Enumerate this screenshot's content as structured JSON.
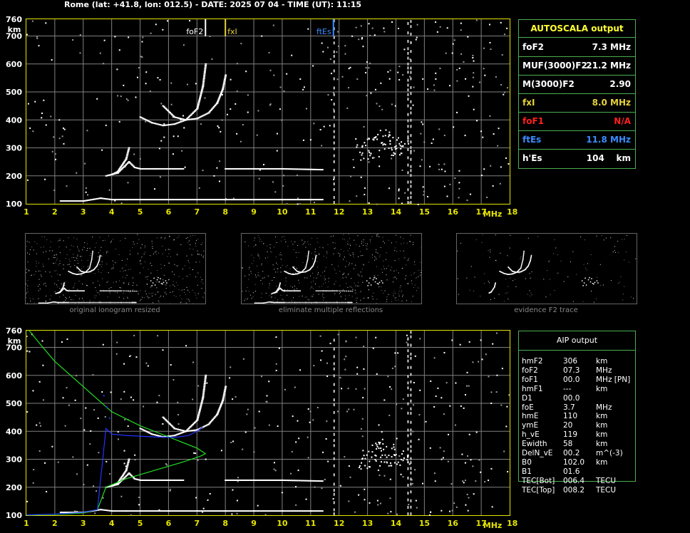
{
  "header": "Rome (lat: +41.8, lon: 012.5) - DATE: 2025 07 04 - TIME (UT): 11:15",
  "autoscala": {
    "title": "AUTOSCALA output",
    "rows": [
      {
        "label": "foF2",
        "value": "7.3 MHz",
        "color": "#ffffff"
      },
      {
        "label": "MUF(3000)F2",
        "value": "21.2 MHz",
        "color": "#ffffff"
      },
      {
        "label": "M(3000)F2",
        "value": "2.90",
        "color": "#ffffff"
      },
      {
        "label": "fxI",
        "value": "8.0 MHz",
        "color": "#e6d23c"
      },
      {
        "label": "foF1",
        "value": "N/A",
        "color": "#ff2020"
      },
      {
        "label": "ftEs",
        "value": "11.8 MHz",
        "color": "#3a8cff"
      },
      {
        "label": "h'Es",
        "value": "104    km",
        "color": "#ffffff"
      }
    ]
  },
  "aip": {
    "title": "AIP output",
    "rows": [
      {
        "label": "hmF2",
        "value": "306",
        "unit": "km"
      },
      {
        "label": "foF2",
        "value": "07.3",
        "unit": "MHz"
      },
      {
        "label": "foF1",
        "value": "00.0",
        "unit": "MHz   [PN]"
      },
      {
        "label": "hmF1",
        "value": "---",
        "unit": "km"
      },
      {
        "label": "D1",
        "value": "00.0",
        "unit": ""
      },
      {
        "label": "foE",
        "value": "3.7",
        "unit": "MHz"
      },
      {
        "label": "hmE",
        "value": "110",
        "unit": "km"
      },
      {
        "label": "ymE",
        "value": "20",
        "unit": "km"
      },
      {
        "label": "h_vE",
        "value": "119",
        "unit": "km"
      },
      {
        "label": "Ewidth",
        "value": "58",
        "unit": "km"
      },
      {
        "label": "DelN_vE",
        "value": "00.2",
        "unit": "m^(-3)"
      },
      {
        "label": "B0",
        "value": "102.0",
        "unit": "km"
      },
      {
        "label": "B1",
        "value": "01.6",
        "unit": ""
      },
      {
        "label": "TEC[Bot]",
        "value": "006.4",
        "unit": "TECU"
      },
      {
        "label": "TEC[Top]",
        "value": "008.2",
        "unit": "TECU"
      }
    ]
  },
  "thumbnails": [
    {
      "caption": "original ionogram resized"
    },
    {
      "caption": "eliminate multiple reflections"
    },
    {
      "caption": "evidence F2 trace"
    }
  ],
  "colors": {
    "axis": "#e6e600",
    "grid": "#808080",
    "box": "#4caf50",
    "trace": "#ffffff",
    "profile": "#22dd22",
    "model": "#2233ff"
  },
  "chart_data": [
    {
      "type": "scatter",
      "name": "autoscala ionogram",
      "xlabel": "MHz",
      "ylabel": "km",
      "xlim": [
        1,
        18
      ],
      "ylim": [
        100,
        760
      ],
      "x_ticks": [
        1,
        2,
        3,
        4,
        5,
        6,
        7,
        8,
        9,
        10,
        11,
        12,
        13,
        14,
        15,
        16,
        17,
        18
      ],
      "x_tick_labels": [
        "1",
        "2",
        "3",
        "4",
        "5",
        "6",
        "7",
        "8",
        "9",
        "10",
        "11",
        "12",
        "13",
        "14",
        "15",
        "16",
        "17",
        "18"
      ],
      "y_ticks": [
        100,
        200,
        300,
        400,
        500,
        600,
        700
      ],
      "y_tick_labels": [
        "100",
        "200",
        "300",
        "400",
        "500",
        "600",
        "700"
      ],
      "grid": true,
      "markers": [
        {
          "label": "foF2",
          "freq": 7.3,
          "color": "#ffffff"
        },
        {
          "label": "fxI",
          "freq": 8.0,
          "color": "#e6d23c"
        },
        {
          "label": "ftEs",
          "freq": 11.8,
          "color": "#3a8cff"
        }
      ],
      "traces": {
        "es_echo": {
          "x": [
            2.2,
            3.0,
            3.6,
            4.0,
            4.5,
            5.0,
            6.0,
            7.0,
            8.0,
            9.0,
            10.0,
            11.0,
            11.4
          ],
          "y": [
            110,
            110,
            120,
            115,
            115,
            115,
            115,
            115,
            115,
            115,
            115,
            115,
            115
          ]
        },
        "es_second": {
          "x": [
            3.8,
            4.2,
            4.6,
            4.8,
            5.0,
            5.5,
            6.0,
            6.5
          ],
          "y": [
            200,
            210,
            250,
            230,
            225,
            225,
            225,
            225
          ]
        },
        "es_second_long": {
          "x": [
            8.0,
            9.0,
            10.0,
            11.4
          ],
          "y": [
            225,
            225,
            225,
            222
          ]
        },
        "es_bump": {
          "x": [
            4.0,
            4.2,
            4.5,
            4.6
          ],
          "y": [
            205,
            215,
            260,
            300
          ]
        },
        "f2_o": {
          "x": [
            5.0,
            5.4,
            5.8,
            6.2,
            6.6,
            7.0,
            7.2,
            7.3
          ],
          "y": [
            410,
            390,
            380,
            385,
            400,
            440,
            520,
            600
          ]
        },
        "f2_x": {
          "x": [
            5.8,
            6.2,
            6.6,
            7.0,
            7.4,
            7.7,
            7.9,
            8.0
          ],
          "y": [
            450,
            410,
            400,
            405,
            425,
            460,
            510,
            560
          ]
        },
        "noise_cluster": {
          "x": [
            12.8,
            13.0,
            13.2,
            13.4,
            13.6,
            13.8,
            14.0,
            14.2,
            13.1,
            13.5,
            13.9,
            12.9,
            14.3,
            13.7
          ],
          "y": [
            320,
            300,
            280,
            330,
            310,
            295,
            305,
            320,
            345,
            350,
            290,
            275,
            300,
            340
          ]
        }
      }
    },
    {
      "type": "line",
      "name": "aip profile",
      "xlabel": "MHz",
      "ylabel": "km",
      "xlim": [
        1,
        18
      ],
      "ylim": [
        100,
        760
      ],
      "x_ticks": [
        1,
        2,
        3,
        4,
        5,
        6,
        7,
        8,
        9,
        10,
        11,
        12,
        13,
        14,
        15,
        16,
        17,
        18
      ],
      "x_tick_labels": [
        "1",
        "2",
        "3",
        "4",
        "5",
        "6",
        "7",
        "8",
        "9",
        "10",
        "11",
        "12",
        "13",
        "14",
        "15",
        "16",
        "17",
        "18"
      ],
      "y_ticks": [
        100,
        200,
        300,
        400,
        500,
        600,
        700
      ],
      "y_tick_labels": [
        "100",
        "200",
        "300",
        "400",
        "500",
        "600",
        "700"
      ],
      "grid": true,
      "profile_green": {
        "x": [
          1.1,
          1.5,
          2.0,
          2.5,
          3.0,
          3.5,
          3.8,
          4.5,
          5.5,
          6.5,
          7.1,
          7.3,
          7.0,
          6.0,
          5.0,
          4.0,
          3.0,
          2.0,
          1.5,
          1.1
        ],
        "y": [
          100,
          102,
          103,
          105,
          108,
          120,
          200,
          230,
          260,
          290,
          310,
          320,
          340,
          380,
          420,
          470,
          560,
          650,
          710,
          760
        ]
      },
      "model_blue": {
        "x": [
          1.0,
          2.0,
          3.0,
          3.5,
          3.8,
          4.0,
          4.5,
          5.5,
          6.2,
          6.7,
          7.0,
          7.2
        ],
        "y": [
          101,
          104,
          110,
          120,
          410,
          390,
          385,
          380,
          378,
          385,
          400,
          415
        ]
      },
      "model_blue_points": {
        "x": [
          3.7,
          3.8,
          3.9
        ],
        "y": [
          530,
          490,
          450
        ]
      }
    }
  ]
}
